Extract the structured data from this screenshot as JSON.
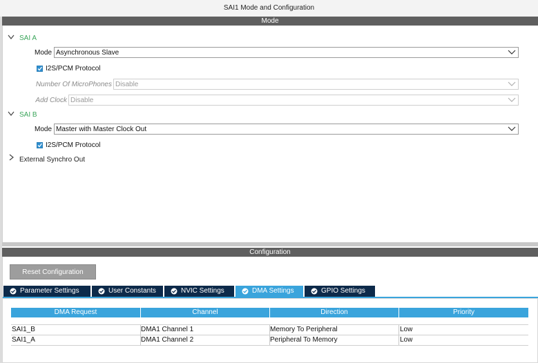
{
  "window": {
    "title": "SAI1 Mode and Configuration"
  },
  "mode_section": {
    "header": "Mode",
    "sai_a": {
      "label": "SAI A",
      "mode_label": "Mode",
      "mode_value": "Asynchronous Slave",
      "protocol_label": "I2S/PCM Protocol",
      "protocol_checked": true,
      "mic_label": "Number Of MicroPhones",
      "mic_value": "Disable",
      "add_clock_label": "Add Clock",
      "add_clock_value": "Disable"
    },
    "sai_b": {
      "label": "SAI B",
      "mode_label": "Mode",
      "mode_value": "Master with Master Clock Out",
      "protocol_label": "I2S/PCM Protocol",
      "protocol_checked": true
    },
    "external_synchro": {
      "label": "External Synchro Out"
    }
  },
  "config_section": {
    "header": "Configuration",
    "reset_button": "Reset Configuration",
    "tabs": [
      {
        "label": "Parameter Settings",
        "active": false
      },
      {
        "label": "User Constants",
        "active": false
      },
      {
        "label": "NVIC Settings",
        "active": false
      },
      {
        "label": "DMA Settings",
        "active": true
      },
      {
        "label": "GPIO Settings",
        "active": false
      }
    ],
    "table": {
      "columns": [
        "DMA Request",
        "Channel",
        "Direction",
        "Priority"
      ],
      "rows": [
        [
          "SAI1_B",
          "DMA1 Channel 1",
          "Memory To Peripheral",
          "Low"
        ],
        [
          "SAI1_A",
          "DMA1 Channel 2",
          "Peripheral To Memory",
          "Low"
        ]
      ]
    }
  },
  "colors": {
    "accent_blue": "#3aa4dc",
    "tab_dark": "#0d2a4a",
    "group_green": "#3aa55a",
    "header_gray": "#5f5f5f"
  }
}
